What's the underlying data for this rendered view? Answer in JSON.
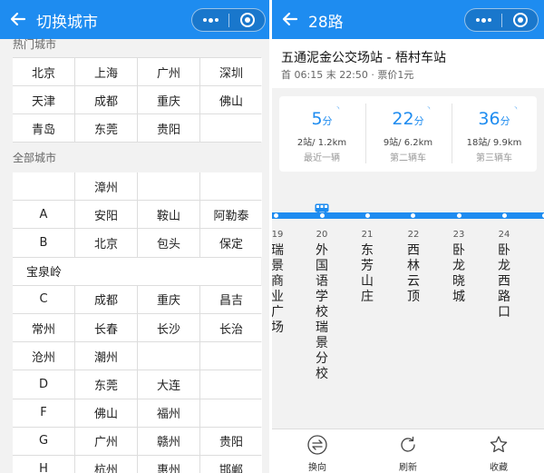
{
  "left": {
    "title": "切换城市",
    "hot_title": "热门城市",
    "hot_cities": [
      [
        "北京",
        "上海",
        "广州",
        "深圳"
      ],
      [
        "天津",
        "成都",
        "重庆",
        "佛山"
      ],
      [
        "青岛",
        "东莞",
        "贵阳",
        ""
      ]
    ],
    "all_title": "全部城市",
    "all_rows": [
      [
        "",
        "漳州",
        "",
        ""
      ],
      [
        "A",
        "安阳",
        "鞍山",
        "阿勒泰"
      ],
      [
        "B",
        "北京",
        "包头",
        "保定"
      ],
      [
        "宝泉岭"
      ],
      [
        "C",
        "成都",
        "重庆",
        "昌吉"
      ],
      [
        "常州",
        "长春",
        "长沙",
        "长治"
      ],
      [
        "沧州",
        "潮州",
        "",
        ""
      ],
      [
        "D",
        "东莞",
        "大连",
        ""
      ],
      [
        "F",
        "佛山",
        "福州",
        ""
      ],
      [
        "G",
        "广州",
        "赣州",
        "贵阳"
      ],
      [
        "H",
        "杭州",
        "惠州",
        "邯郸"
      ]
    ]
  },
  "right": {
    "title": "28路",
    "route": "五通泥金公交场站 - 梧村车站",
    "info": "首 06:15 末 22:50 · 票价1元",
    "arrivals": [
      {
        "minutes": "5",
        "unit": "分",
        "dist": "2站/ 1.2km",
        "label": "最近一辆"
      },
      {
        "minutes": "22",
        "unit": "分",
        "dist": "9站/ 6.2km",
        "label": "第二辆车"
      },
      {
        "minutes": "36",
        "unit": "分",
        "dist": "18站/ 9.9km",
        "label": "第三辆车"
      }
    ],
    "stops": [
      {
        "no": "19",
        "name": "瑞景商业广场"
      },
      {
        "no": "20",
        "name": "外国语学校瑞景分校"
      },
      {
        "no": "21",
        "name": "东芳山庄"
      },
      {
        "no": "22",
        "name": "西林云顶"
      },
      {
        "no": "23",
        "name": "卧龙晓城"
      },
      {
        "no": "24",
        "name": "卧龙西路口"
      }
    ],
    "toolbar": {
      "reverse": "换向",
      "refresh": "刷新",
      "favorite": "收藏"
    }
  },
  "colors": {
    "accent": "#1e8cf0",
    "background": "#f2f2f2"
  },
  "icons": [
    "back-arrow-icon",
    "more-dots-icon",
    "close-target-icon",
    "bus-icon",
    "swap-icon",
    "refresh-icon",
    "star-icon",
    "signal-icon"
  ]
}
